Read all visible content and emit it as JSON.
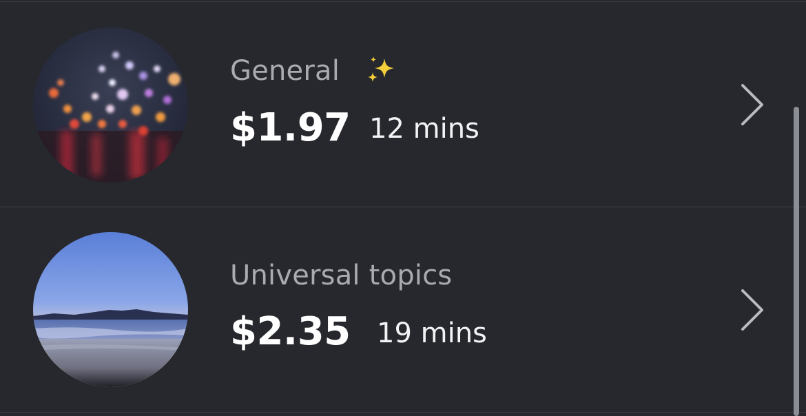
{
  "rows": [
    {
      "title": "General",
      "price": "$1.97",
      "duration": "12 mins",
      "badge_icon": "sparkles-icon",
      "thumbnail": "city-bokeh-lights"
    },
    {
      "title": "Universal topics",
      "price": "$2.35",
      "duration": "19 mins",
      "thumbnail": "beach-sunset"
    }
  ],
  "colors": {
    "background": "#26282d",
    "title": "#a9abb0",
    "price": "#ffffff",
    "chevron": "#b8bbc0",
    "sparkle": "#f4cf3a"
  }
}
